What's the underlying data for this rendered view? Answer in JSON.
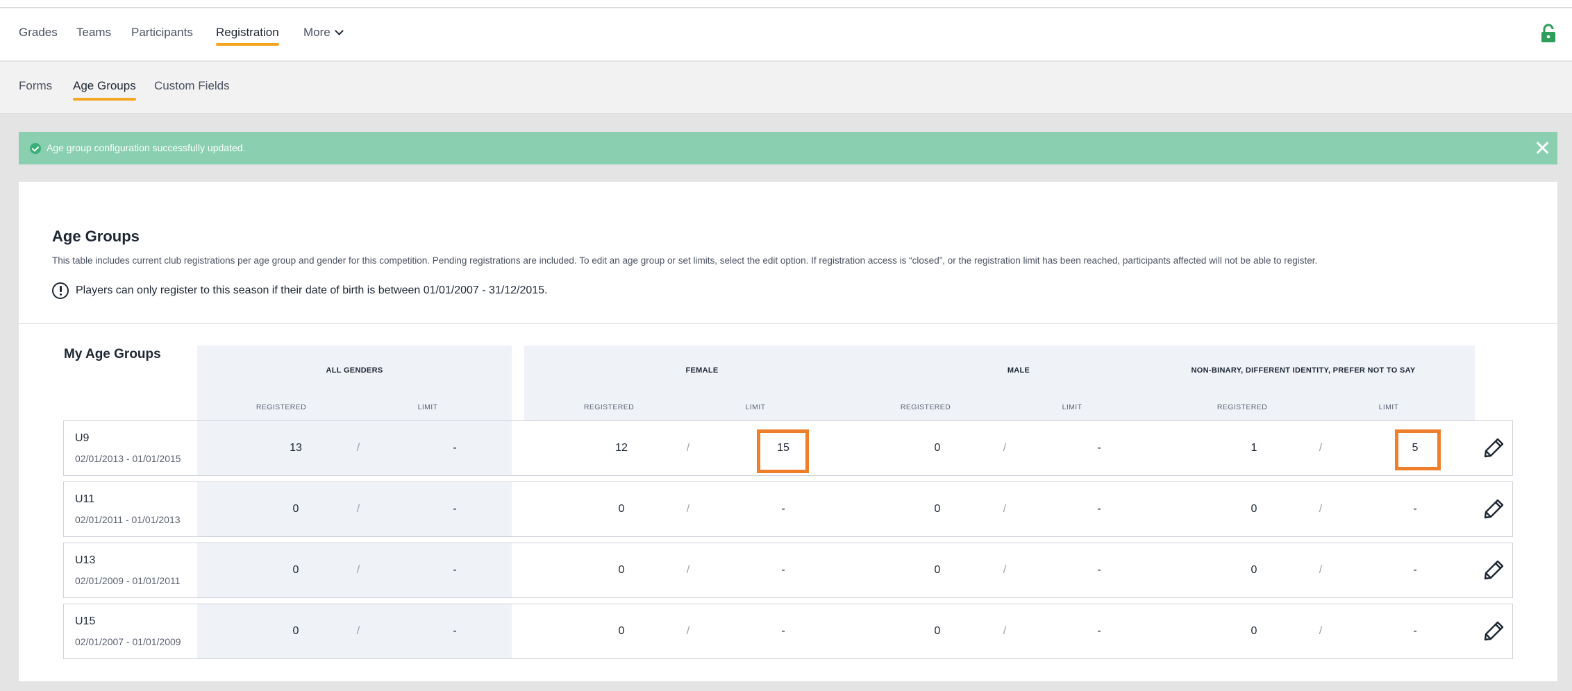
{
  "nav": {
    "tabs": [
      {
        "label": "Grades"
      },
      {
        "label": "Teams"
      },
      {
        "label": "Participants"
      },
      {
        "label": "Registration"
      },
      {
        "label": "More"
      }
    ]
  },
  "subnav": {
    "tabs": [
      {
        "label": "Forms"
      },
      {
        "label": "Age Groups"
      },
      {
        "label": "Custom Fields"
      }
    ]
  },
  "alert": {
    "message": "Age group configuration successfully updated.",
    "color": "#89cfb0"
  },
  "card": {
    "title": "Age Groups",
    "description": "This table includes current club registrations per age group and gender for this competition. Pending registrations are included. To edit an age group or set limits, select the edit option. If registration access is “closed”, or the registration limit has been reached, participants affected will not be able to register.",
    "info": "Players can only register to this season if their date of birth is between 01/01/2007 - 31/12/2015."
  },
  "table": {
    "title": "My Age Groups",
    "groups": [
      "ALL GENDERS",
      "FEMALE",
      "MALE",
      "NON-BINARY, DIFFERENT IDENTITY, PREFER NOT TO SAY"
    ],
    "sub_registered": "REGISTERED",
    "sub_limit": "LIMIT",
    "slash": "/",
    "rows": [
      {
        "name": "U9",
        "range": "02/01/2013 - 01/01/2015",
        "cells": [
          "13",
          "-",
          "12",
          "15",
          "0",
          "-",
          "1",
          "5"
        ]
      },
      {
        "name": "U11",
        "range": "02/01/2011 - 01/01/2013",
        "cells": [
          "0",
          "-",
          "0",
          "-",
          "0",
          "-",
          "0",
          "-"
        ]
      },
      {
        "name": "U13",
        "range": "02/01/2009 - 01/01/2011",
        "cells": [
          "0",
          "-",
          "0",
          "-",
          "0",
          "-",
          "0",
          "-"
        ]
      },
      {
        "name": "U15",
        "range": "02/01/2007 - 01/01/2009",
        "cells": [
          "0",
          "-",
          "0",
          "-",
          "0",
          "-",
          "0",
          "-"
        ]
      }
    ]
  },
  "colors": {
    "accent_underline": "#f5a623",
    "highlight": "#f07f2b",
    "lock": "#2e9e5a"
  }
}
